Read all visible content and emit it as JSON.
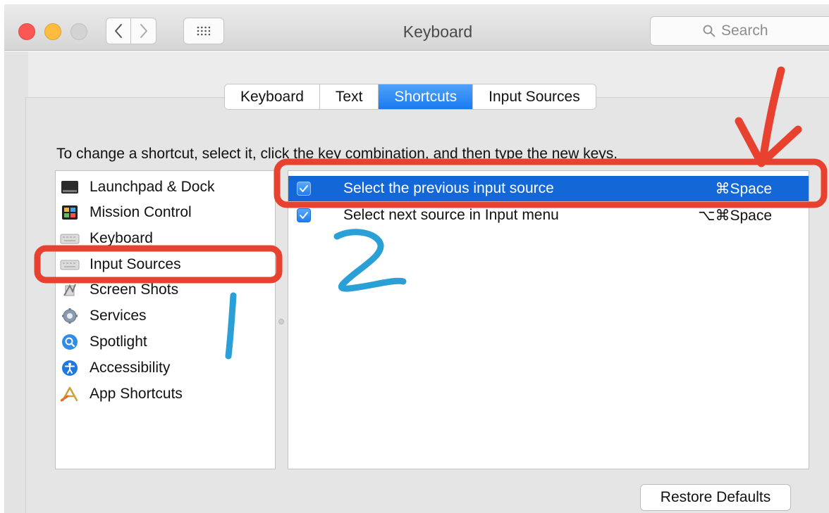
{
  "window": {
    "title": "Keyboard"
  },
  "search": {
    "placeholder": "Search"
  },
  "tabs": [
    {
      "label": "Keyboard",
      "active": false
    },
    {
      "label": "Text",
      "active": false
    },
    {
      "label": "Shortcuts",
      "active": true
    },
    {
      "label": "Input Sources",
      "active": false
    }
  ],
  "instructions": "To change a shortcut, select it, click the key combination, and then type the new keys.",
  "categories": [
    {
      "label": "Launchpad & Dock",
      "icon": "launchpad-dock-icon"
    },
    {
      "label": "Mission Control",
      "icon": "mission-control-icon"
    },
    {
      "label": "Keyboard",
      "icon": "keyboard-icon"
    },
    {
      "label": "Input Sources",
      "icon": "input-sources-icon"
    },
    {
      "label": "Screen Shots",
      "icon": "screenshot-icon"
    },
    {
      "label": "Services",
      "icon": "services-gear-icon"
    },
    {
      "label": "Spotlight",
      "icon": "spotlight-icon"
    },
    {
      "label": "Accessibility",
      "icon": "accessibility-icon"
    },
    {
      "label": "App Shortcuts",
      "icon": "app-shortcuts-icon"
    }
  ],
  "shortcuts": [
    {
      "label": "Select the previous input source",
      "keys": "⌘Space",
      "checked": true,
      "selected": true
    },
    {
      "label": "Select next source in Input menu",
      "keys": "⌥⌘Space",
      "checked": true,
      "selected": false
    }
  ],
  "restore_label": "Restore Defaults",
  "colors": {
    "accent": "#1467d6",
    "annotation_red": "#e8412f",
    "annotation_blue": "#2aa0d6"
  },
  "annotations": {
    "numbers": [
      "1",
      "2"
    ]
  }
}
